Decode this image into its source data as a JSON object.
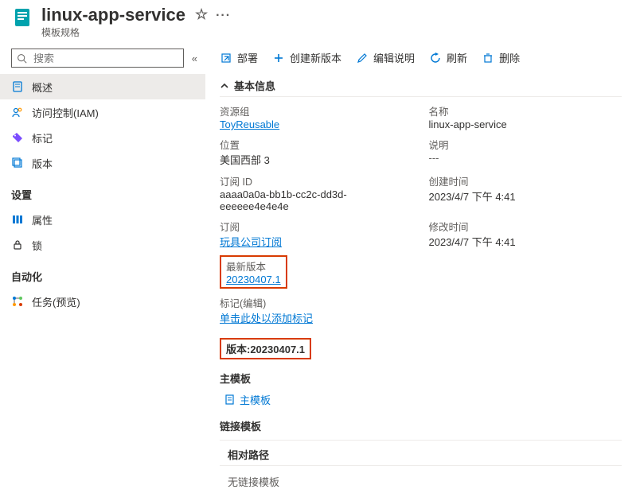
{
  "header": {
    "title": "linux-app-service",
    "subtitle": "模板规格"
  },
  "sidebar": {
    "search_placeholder": "搜索",
    "items": [
      {
        "label": "概述"
      },
      {
        "label": "访问控制(IAM)"
      },
      {
        "label": "标记"
      },
      {
        "label": "版本"
      }
    ],
    "section_settings": "设置",
    "settings_items": [
      {
        "label": "属性"
      },
      {
        "label": "锁"
      }
    ],
    "section_automation": "自动化",
    "automation_items": [
      {
        "label": "任务(预览)"
      }
    ]
  },
  "toolbar": {
    "deploy": "部署",
    "create_version": "创建新版本",
    "edit_desc": "编辑说明",
    "refresh": "刷新",
    "delete": "删除"
  },
  "essentials": {
    "heading": "基本信息",
    "labels": {
      "resource_group": "资源组",
      "name": "名称",
      "location": "位置",
      "description": "说明",
      "subscription_id": "订阅 ID",
      "created": "创建时间",
      "subscription": "订阅",
      "modified": "修改时间",
      "latest_version": "最新版本",
      "tags": "标记",
      "edit_paren": "(编辑)"
    },
    "values": {
      "resource_group": "ToyReusable",
      "name": "linux-app-service",
      "location": "美国西部 3",
      "description": "---",
      "subscription_id": "aaaa0a0a-bb1b-cc2c-dd3d-eeeeee4e4e4e",
      "created": "2023/4/7 下午 4:41",
      "subscription": "玩具公司订阅",
      "modified": "2023/4/7 下午 4:41",
      "latest_version": "20230407.1",
      "tags_link": "单击此处以添加标记"
    }
  },
  "version_banner": "版本:20230407.1",
  "main_template": {
    "heading": "主模板",
    "link": "主模板"
  },
  "linked_templates": {
    "heading": "链接模板",
    "col": "相对路径",
    "empty": "无链接模板"
  }
}
